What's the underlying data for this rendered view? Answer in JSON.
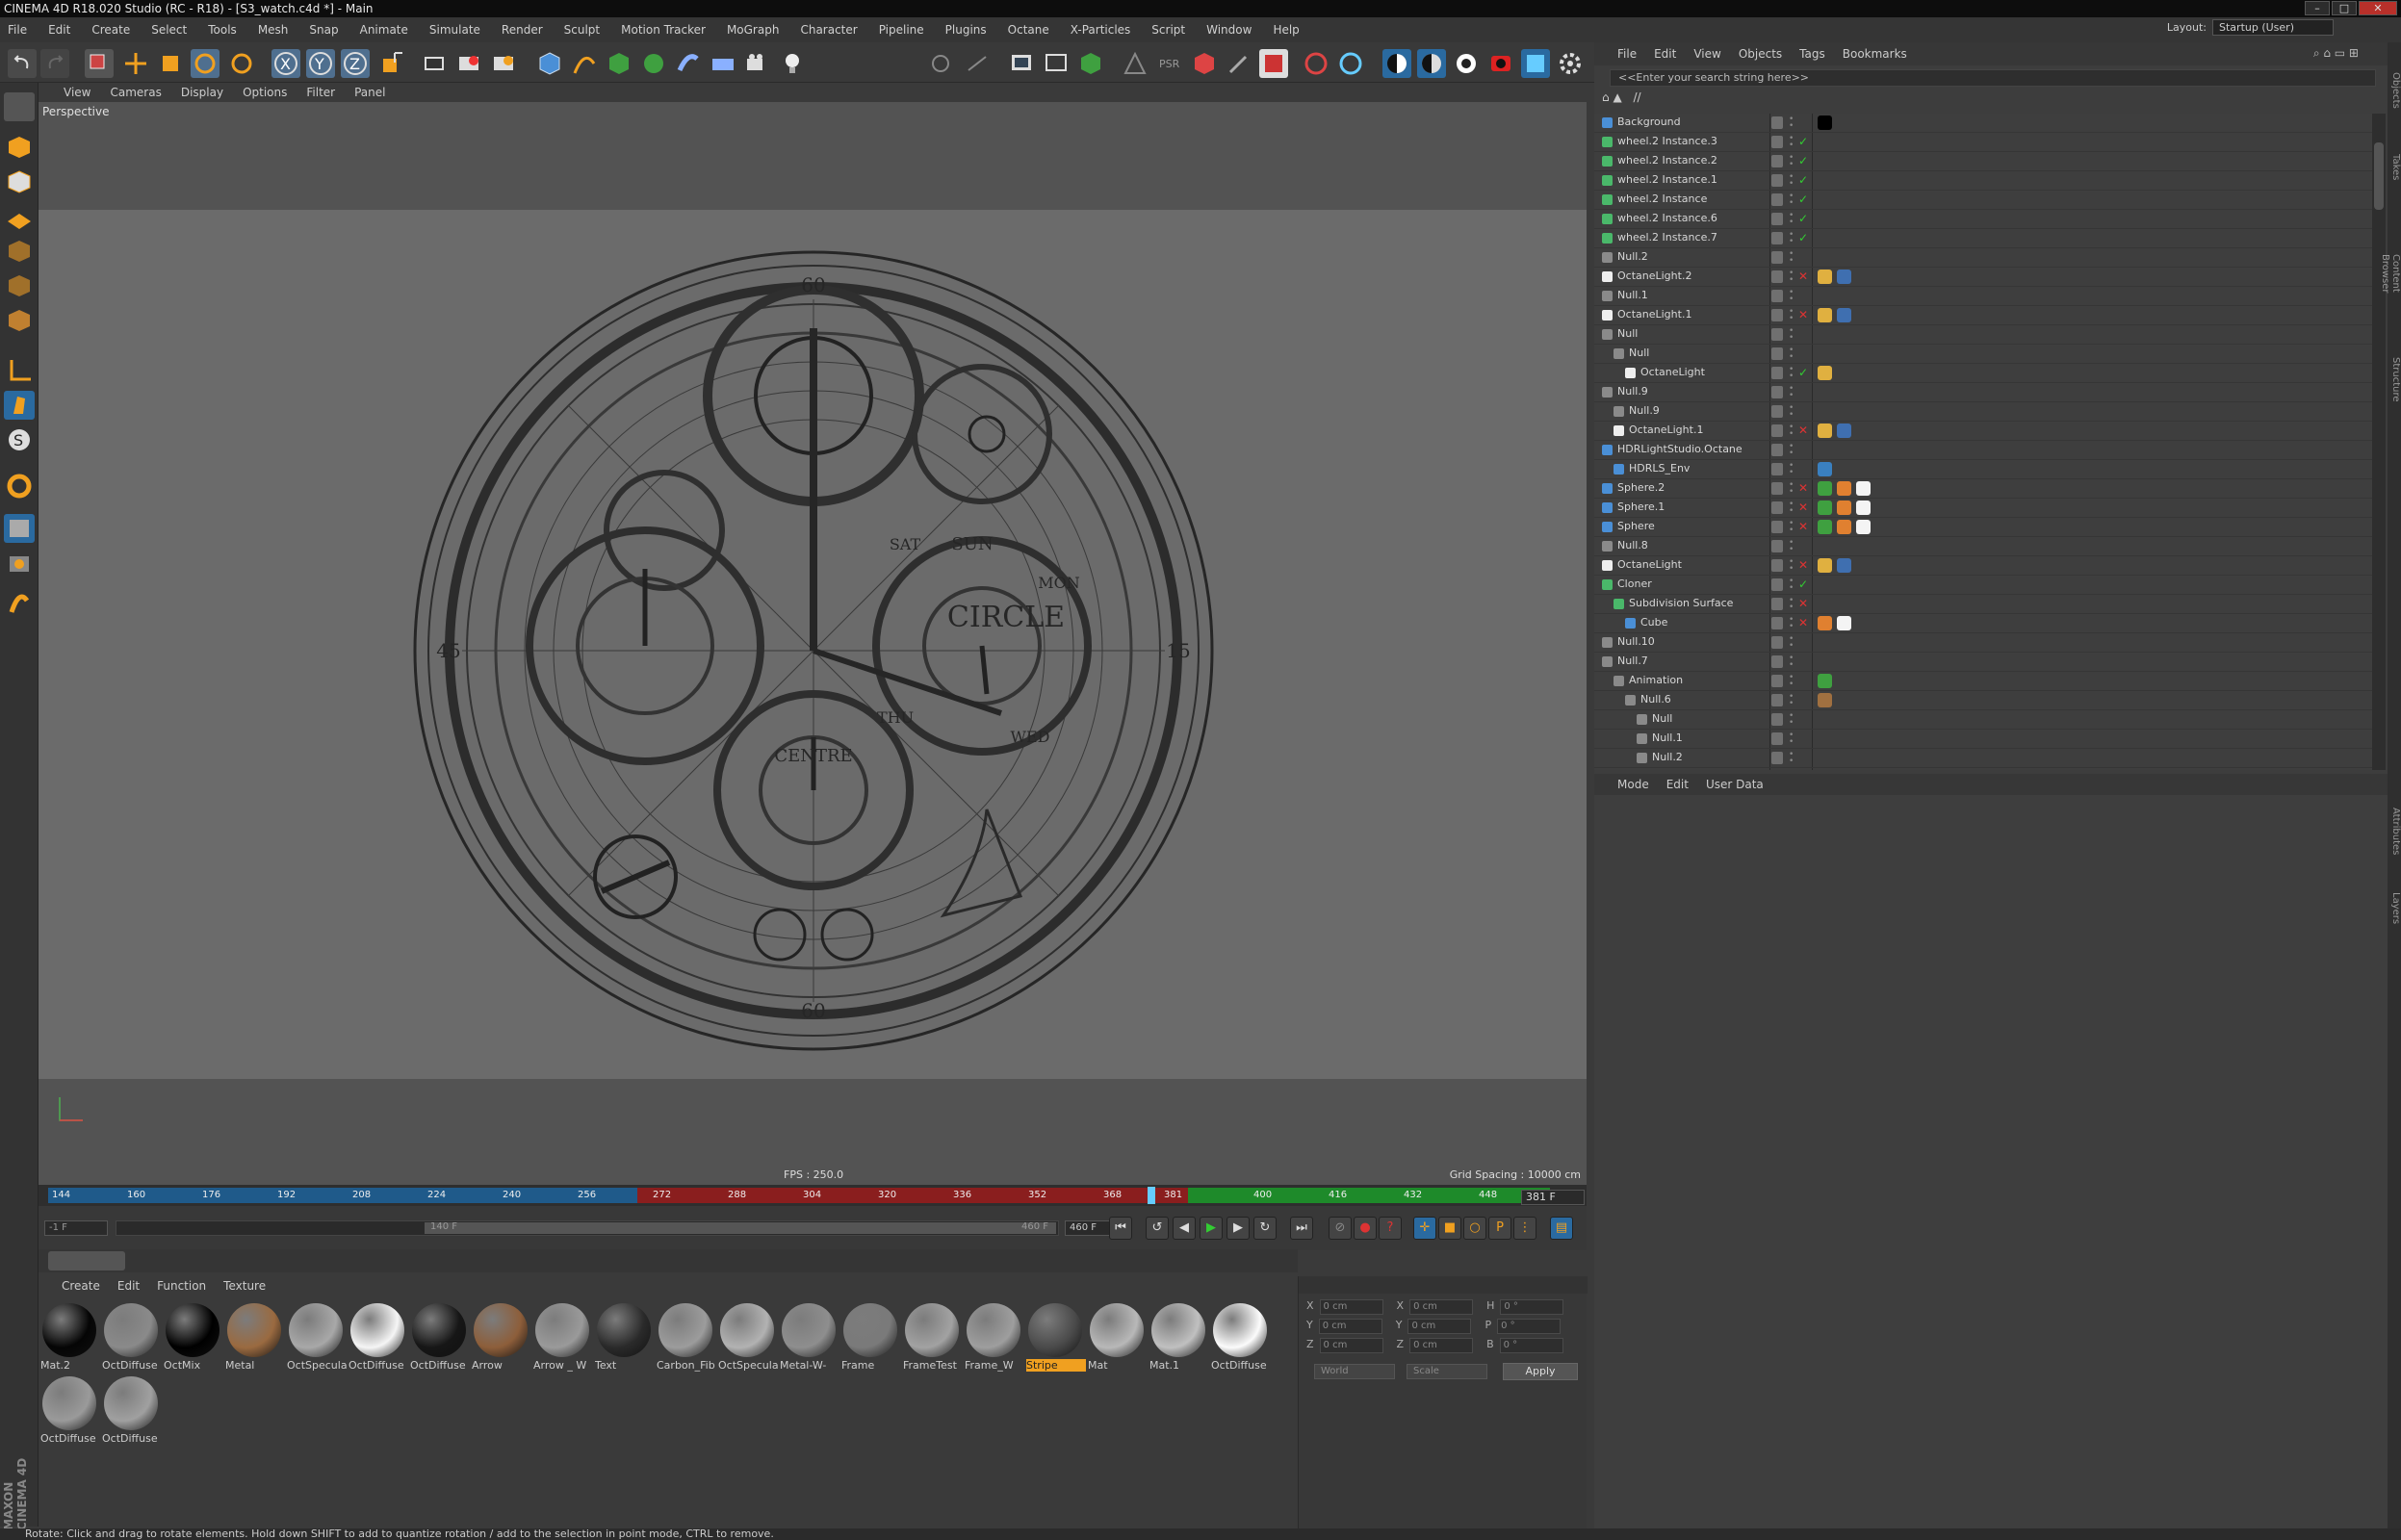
{
  "window": {
    "title": "CINEMA 4D R18.020 Studio (RC - R18) - [S3_watch.c4d *] - Main"
  },
  "menu": [
    "File",
    "Edit",
    "Create",
    "Select",
    "Tools",
    "Mesh",
    "Snap",
    "Animate",
    "Simulate",
    "Render",
    "Sculpt",
    "Motion Tracker",
    "MoGraph",
    "Character",
    "Pipeline",
    "Plugins",
    "Octane",
    "X-Particles",
    "Script",
    "Window",
    "Help"
  ],
  "layout": {
    "label": "Layout:",
    "value": "Startup (User)"
  },
  "viewport": {
    "menu": [
      "View",
      "Cameras",
      "Display",
      "Options",
      "Filter",
      "Panel"
    ],
    "camera_label": "Perspective",
    "fps": "FPS : 250.0",
    "grid_spacing": "Grid Spacing : 10000 cm",
    "dial_labels": {
      "top": "60",
      "bottom": "60",
      "left": "45",
      "right": "15",
      "brand": "CIRCLE",
      "sub_brand": "CENTRE",
      "day_sun": "SUN",
      "day_mon": "MON",
      "day_sat": "SAT",
      "day_thu": "THU",
      "day_wed": "WED"
    }
  },
  "timeline": {
    "ticks": [
      "144",
      "160",
      "176",
      "192",
      "208",
      "224",
      "240",
      "256",
      "272",
      "288",
      "304",
      "320",
      "336",
      "352",
      "368",
      "381",
      "400",
      "416",
      "432",
      "448"
    ],
    "current": "381 F"
  },
  "playbar": {
    "start": "-1 F",
    "range_start": "140 F",
    "range_end": "460 F",
    "end": "460 F"
  },
  "material_menu": [
    "Create",
    "Edit",
    "Function",
    "Texture"
  ],
  "materials": [
    {
      "name": "Mat.2",
      "color": "#050505"
    },
    {
      "name": "OctDiffuse",
      "color": "#8a8a8a"
    },
    {
      "name": "OctMix",
      "color": "#000000"
    },
    {
      "name": "Metal",
      "color": "#9a6a40"
    },
    {
      "name": "OctSpecula",
      "color": "#a8a8a8"
    },
    {
      "name": "OctDiffuse",
      "color": "#f5f5f5"
    },
    {
      "name": "OctDiffuse",
      "color": "#161616"
    },
    {
      "name": "Arrow",
      "color": "#8d5e3a"
    },
    {
      "name": "Arrow _ W",
      "color": "#9a9a9a"
    },
    {
      "name": "Text",
      "color": "#2a2a2a"
    },
    {
      "name": "Carbon_Fib",
      "color": "#9c9c9c"
    },
    {
      "name": "OctSpecula",
      "color": "#b2b2b2"
    },
    {
      "name": "Metal-W-",
      "color": "#8e8e8e"
    },
    {
      "name": "Frame",
      "color": "#7a7a7a"
    },
    {
      "name": "FrameTest",
      "color": "#a2a2a2"
    },
    {
      "name": "Frame_W",
      "color": "#9e9e9e"
    },
    {
      "name": "Stripe",
      "color": "#4a4a4a",
      "selected": true
    },
    {
      "name": "Mat",
      "color": "#b8b8b8"
    },
    {
      "name": "Mat.1",
      "color": "#c0c0c0"
    },
    {
      "name": "OctDiffuse",
      "color": "#fbfbfb"
    },
    {
      "name": "OctDiffuse",
      "color": "#9a9a9a"
    },
    {
      "name": "OctDiffuse",
      "color": "#a0a0a0"
    }
  ],
  "coords": {
    "rows": [
      {
        "a": "X",
        "av": "0 cm",
        "b": "X",
        "bv": "0 cm",
        "c": "H",
        "cv": "0 °"
      },
      {
        "a": "Y",
        "av": "0 cm",
        "b": "Y",
        "bv": "0 cm",
        "c": "P",
        "cv": "0 °"
      },
      {
        "a": "Z",
        "av": "0 cm",
        "b": "Z",
        "bv": "0 cm",
        "c": "B",
        "cv": "0 °"
      }
    ],
    "world": "World",
    "scale": "Scale",
    "apply": "Apply"
  },
  "object_manager": {
    "menu": [
      "File",
      "Edit",
      "View",
      "Objects",
      "Tags",
      "Bookmarks"
    ],
    "search_placeholder": "<<Enter your search string here>>",
    "path": "//",
    "objects": [
      {
        "name": "Background",
        "indent": 0,
        "icon": "#4a8fd6",
        "status": "",
        "tags": [
          "#000000"
        ]
      },
      {
        "name": "wheel.2 Instance.3",
        "indent": 0,
        "icon": "#4ab86a",
        "status": "✓",
        "tags": []
      },
      {
        "name": "wheel.2 Instance.2",
        "indent": 0,
        "icon": "#4ab86a",
        "status": "✓",
        "tags": []
      },
      {
        "name": "wheel.2 Instance.1",
        "indent": 0,
        "icon": "#4ab86a",
        "status": "✓",
        "tags": []
      },
      {
        "name": "wheel.2 Instance",
        "indent": 0,
        "icon": "#4ab86a",
        "status": "✓",
        "tags": []
      },
      {
        "name": "wheel.2 Instance.6",
        "indent": 0,
        "icon": "#4ab86a",
        "status": "✓",
        "tags": []
      },
      {
        "name": "wheel.2 Instance.7",
        "indent": 0,
        "icon": "#4ab86a",
        "status": "✓",
        "tags": []
      },
      {
        "name": "Null.2",
        "indent": 0,
        "icon": "#8a8a8a",
        "status": "",
        "tags": []
      },
      {
        "name": "OctaneLight.2",
        "indent": 0,
        "icon": "#eeeeee",
        "status": "✕",
        "tags": [
          "#e0b040",
          "#3f6fb0"
        ]
      },
      {
        "name": "Null.1",
        "indent": 0,
        "icon": "#8a8a8a",
        "status": "",
        "tags": []
      },
      {
        "name": "OctaneLight.1",
        "indent": 0,
        "icon": "#eeeeee",
        "status": "✕",
        "tags": [
          "#e0b040",
          "#3f6fb0"
        ]
      },
      {
        "name": "Null",
        "indent": 0,
        "icon": "#8a8a8a",
        "status": "",
        "tags": []
      },
      {
        "name": "Null",
        "indent": 1,
        "icon": "#8a8a8a",
        "status": "",
        "tags": []
      },
      {
        "name": "OctaneLight",
        "indent": 2,
        "icon": "#eeeeee",
        "status": "✓",
        "tags": [
          "#e0b040"
        ]
      },
      {
        "name": "Null.9",
        "indent": 0,
        "icon": "#8a8a8a",
        "status": "",
        "tags": []
      },
      {
        "name": "Null.9",
        "indent": 1,
        "icon": "#8a8a8a",
        "status": "",
        "tags": []
      },
      {
        "name": "OctaneLight.1",
        "indent": 1,
        "icon": "#eeeeee",
        "status": "✕",
        "tags": [
          "#e0b040",
          "#3f6fb0"
        ]
      },
      {
        "name": "HDRLightStudio.Octane",
        "indent": 0,
        "icon": "#4a8fd6",
        "status": "",
        "tags": []
      },
      {
        "name": "HDRLS_Env",
        "indent": 1,
        "icon": "#4a8fd6",
        "status": "",
        "tags": [
          "#3a80c0"
        ]
      },
      {
        "name": "Sphere.2",
        "indent": 0,
        "icon": "#4a8fd6",
        "status": "✕",
        "tags": [
          "#3fa040",
          "#e08030",
          "#f4f4f4"
        ]
      },
      {
        "name": "Sphere.1",
        "indent": 0,
        "icon": "#4a8fd6",
        "status": "✕",
        "tags": [
          "#3fa040",
          "#e08030",
          "#f4f4f4"
        ]
      },
      {
        "name": "Sphere",
        "indent": 0,
        "icon": "#4a8fd6",
        "status": "✕",
        "tags": [
          "#3fa040",
          "#e08030",
          "#f4f4f4"
        ]
      },
      {
        "name": "Null.8",
        "indent": 0,
        "icon": "#8a8a8a",
        "status": "",
        "tags": []
      },
      {
        "name": "OctaneLight",
        "indent": 0,
        "icon": "#eeeeee",
        "status": "✕",
        "tags": [
          "#e0b040",
          "#3f6fb0"
        ]
      },
      {
        "name": "Cloner",
        "indent": 0,
        "icon": "#4ab86a",
        "status": "✓",
        "tags": []
      },
      {
        "name": "Subdivision Surface",
        "indent": 1,
        "icon": "#4ab86a",
        "status": "✕",
        "tags": []
      },
      {
        "name": "Cube",
        "indent": 2,
        "icon": "#4a8fd6",
        "status": "✕",
        "tags": [
          "#e08030",
          "#f4f4f4"
        ]
      },
      {
        "name": "Null.10",
        "indent": 0,
        "icon": "#8a8a8a",
        "status": "",
        "tags": []
      },
      {
        "name": "Null.7",
        "indent": 0,
        "icon": "#8a8a8a",
        "status": "",
        "tags": []
      },
      {
        "name": "Animation",
        "indent": 1,
        "icon": "#8a8a8a",
        "status": "",
        "tags": [
          "#3fa040"
        ]
      },
      {
        "name": "Null.6",
        "indent": 2,
        "icon": "#8a8a8a",
        "status": "",
        "tags": [
          "#a07040"
        ]
      },
      {
        "name": "Null",
        "indent": 3,
        "icon": "#8a8a8a",
        "status": "",
        "tags": []
      },
      {
        "name": "Null.1",
        "indent": 3,
        "icon": "#8a8a8a",
        "status": "",
        "tags": []
      },
      {
        "name": "Null.2",
        "indent": 3,
        "icon": "#8a8a8a",
        "status": "",
        "tags": []
      }
    ]
  },
  "attribute_manager": {
    "menu": [
      "Mode",
      "Edit",
      "User Data"
    ]
  },
  "side_tabs": [
    "Objects",
    "Takes",
    "Content Browser",
    "Structure",
    "Attributes",
    "Layers"
  ],
  "status": "Rotate: Click and drag to rotate elements. Hold down SHIFT to add to quantize rotation / add to the selection in point mode, CTRL to remove.",
  "brand": "MAXON CINEMA 4D",
  "colors": {
    "accent": "#f0a020",
    "timeline_blue": "#1f5a8a",
    "timeline_red": "#8a1e1e",
    "timeline_green": "#1e8a2a"
  }
}
